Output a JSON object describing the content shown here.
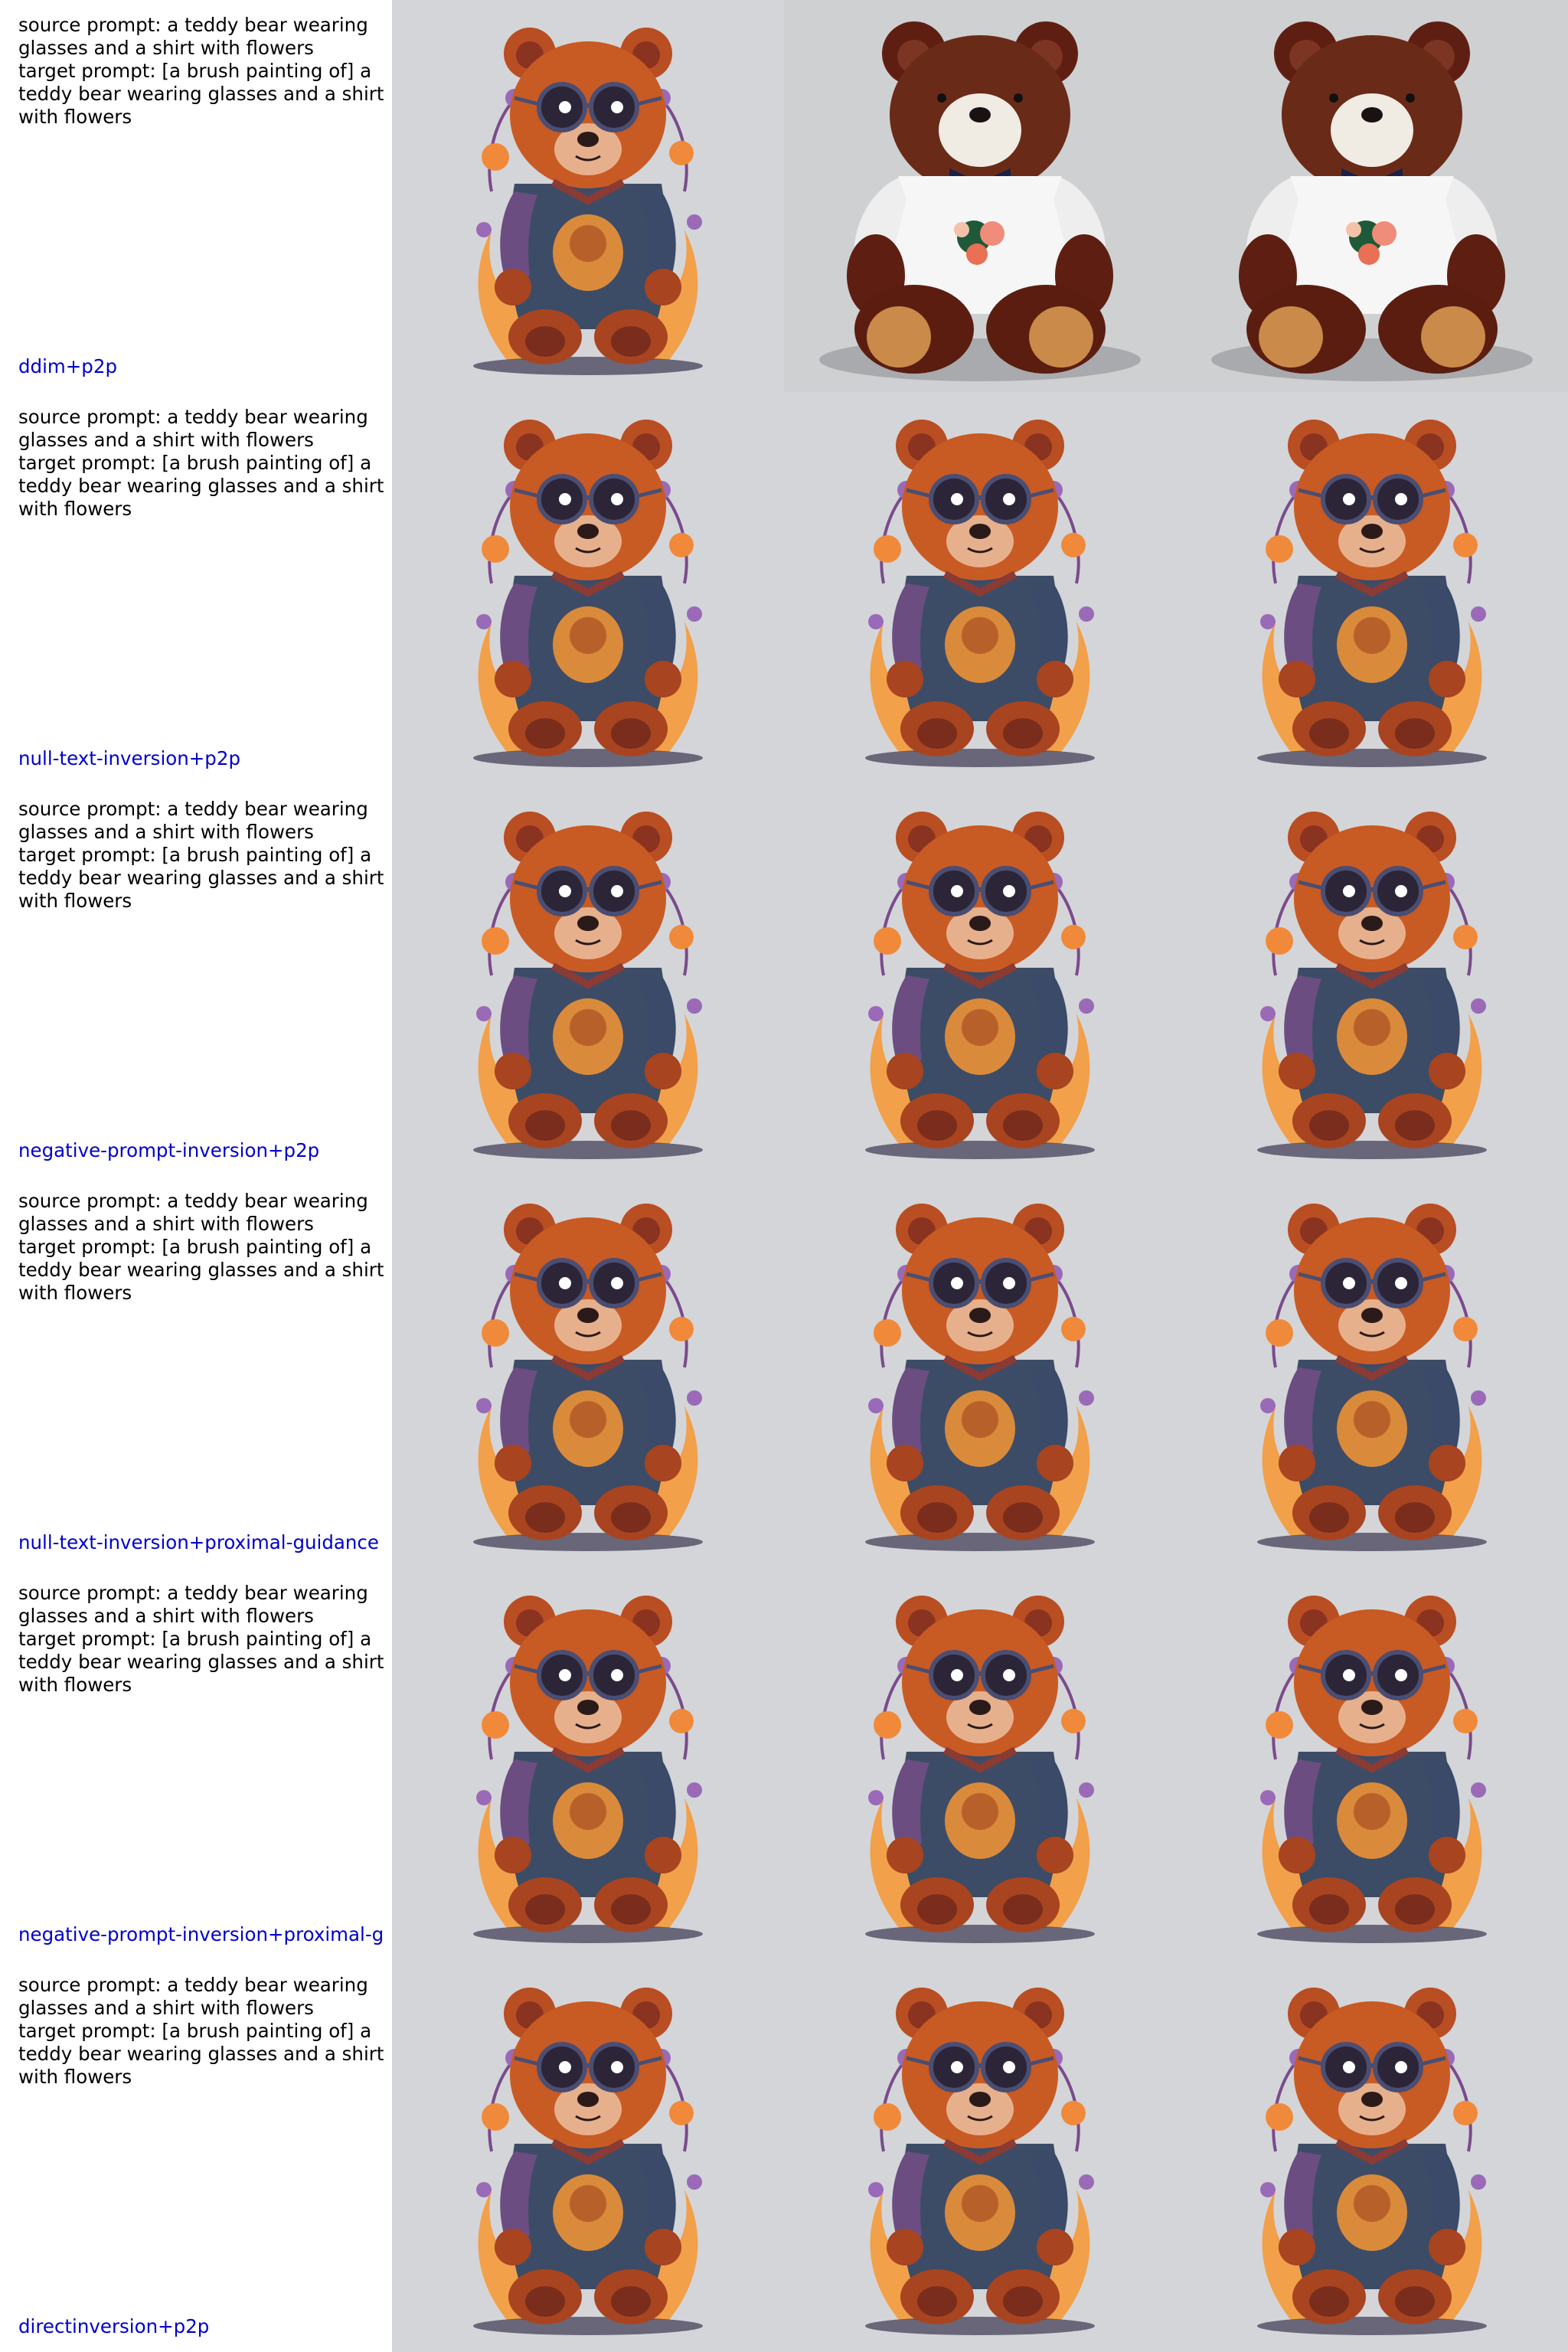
{
  "rows": [
    {
      "source_prompt": "source prompt: a teddy bear wearing glasses and a shirt with flowers",
      "target_prompt": "target prompt: [a brush painting of] a teddy bear wearing glasses and a shirt with flowers",
      "method": "ddim+p2p",
      "images": [
        "illustrated-teddy-bear-image",
        "plush-teddy-bear-photo",
        "plush-teddy-bear-photo"
      ]
    },
    {
      "source_prompt": "source prompt: a teddy bear wearing glasses and a shirt with flowers",
      "target_prompt": "target prompt: [a brush painting of] a teddy bear wearing glasses and a shirt with flowers",
      "method": "null-text-inversion+p2p",
      "images": [
        "illustrated-teddy-bear-image",
        "illustrated-teddy-bear-image",
        "illustrated-teddy-bear-image"
      ]
    },
    {
      "source_prompt": "source prompt: a teddy bear wearing glasses and a shirt with flowers",
      "target_prompt": "target prompt: [a brush painting of] a teddy bear wearing glasses and a shirt with flowers",
      "method": "negative-prompt-inversion+p2p",
      "images": [
        "illustrated-teddy-bear-image",
        "illustrated-teddy-bear-image",
        "illustrated-teddy-bear-image"
      ]
    },
    {
      "source_prompt": "source prompt: a teddy bear wearing glasses and a shirt with flowers",
      "target_prompt": "target prompt: [a brush painting of] a teddy bear wearing glasses and a shirt with flowers",
      "method": "null-text-inversion+proximal-guidance",
      "images": [
        "illustrated-teddy-bear-image",
        "illustrated-teddy-bear-image",
        "illustrated-teddy-bear-image"
      ]
    },
    {
      "source_prompt": "source prompt: a teddy bear wearing glasses and a shirt with flowers",
      "target_prompt": "target prompt: [a brush painting of] a teddy bear wearing glasses and a shirt with flowers",
      "method": "negative-prompt-inversion+proximal-g",
      "images": [
        "illustrated-teddy-bear-image",
        "illustrated-teddy-bear-image",
        "illustrated-teddy-bear-image"
      ]
    },
    {
      "source_prompt": "source prompt: a teddy bear wearing glasses and a shirt with flowers",
      "target_prompt": "target prompt: [a brush painting of] a teddy bear wearing glasses and a shirt with flowers",
      "method": "directinversion+p2p",
      "images": [
        "illustrated-teddy-bear-image",
        "illustrated-teddy-bear-image",
        "illustrated-teddy-bear-image"
      ]
    }
  ],
  "colors": {
    "prompt_text": "#000000",
    "method_text": "#0000cc",
    "image_background": "#d4d5d8",
    "bear_orange": "#c85a24",
    "bear_dark": "#7a2d1c",
    "shirt_blue": "#3d4c66",
    "flower_orange": "#f2a04a",
    "flower_purple": "#9a6ab8"
  }
}
